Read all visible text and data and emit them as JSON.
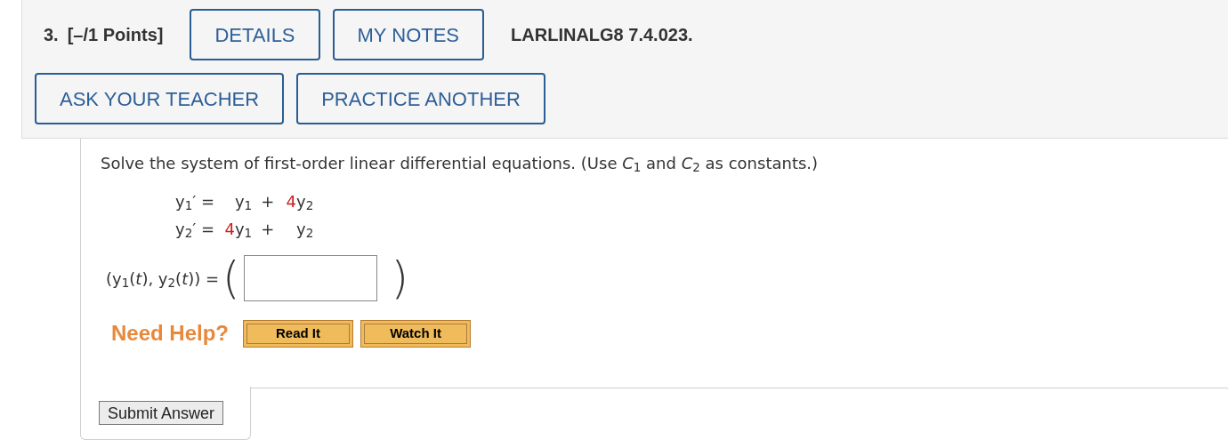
{
  "header": {
    "number": "3.",
    "points": "[–/1 Points]",
    "buttons": [
      {
        "label": "DETAILS"
      },
      {
        "label": "MY NOTES"
      }
    ],
    "source": "LARLINALG8 7.4.023.",
    "actions": [
      {
        "label": "ASK YOUR TEACHER"
      },
      {
        "label": "PRACTICE ANOTHER"
      }
    ]
  },
  "question": {
    "prompt": "Solve the system of first-order linear differential equations. (Use *C*$_{1}$ and *C*$_{2}$ as constants.)",
    "equations": [
      {
        "lhs": "y$_{1}$′ =",
        "rhs": [
          {
            "kind": "var",
            "s": "y$_{1}$"
          },
          {
            "kind": "op",
            "s": "+"
          },
          {
            "kind": "coef",
            "s": "4"
          },
          {
            "kind": "var",
            "s": "y$_{2}$"
          }
        ]
      },
      {
        "lhs": "y$_{2}$′ =",
        "rhs": [
          {
            "kind": "coef",
            "s": "4"
          },
          {
            "kind": "var",
            "s": "y$_{1}$"
          },
          {
            "kind": "op",
            "s": "+"
          },
          {
            "kind": "var",
            "s": "y$_{2}$"
          }
        ]
      }
    ],
    "answer_label": "(y$_{1}$(*t*), y$_{2}$(*t*)) =",
    "open_paren": "(",
    "close_paren": ")"
  },
  "help": {
    "label": "Need Help?",
    "buttons": [
      {
        "label": "Read It"
      },
      {
        "label": "Watch It"
      }
    ]
  },
  "submit": {
    "label": "Submit Answer"
  }
}
